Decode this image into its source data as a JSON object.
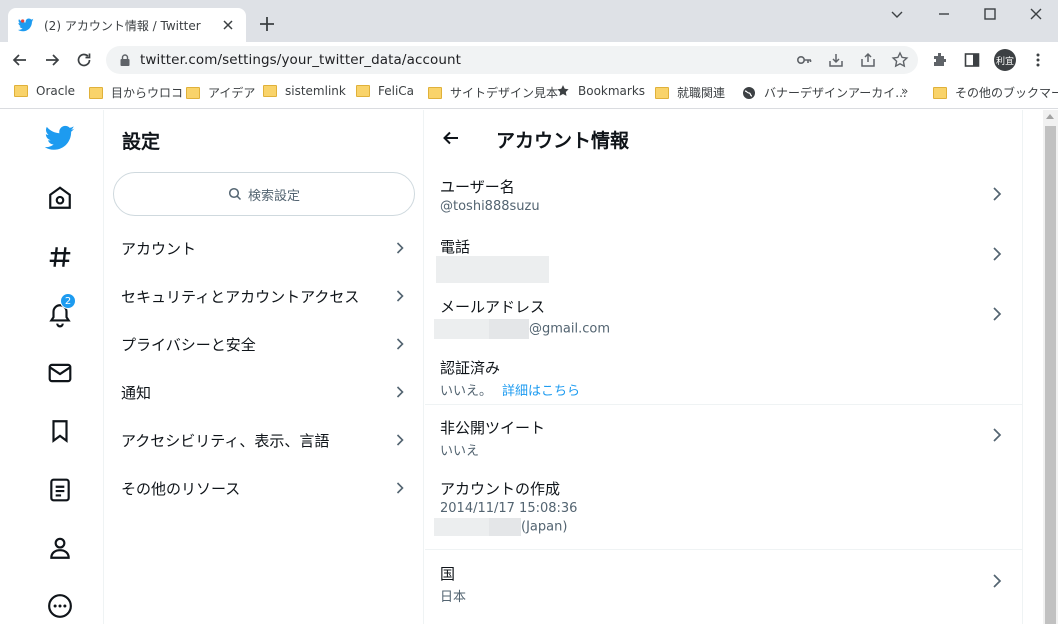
{
  "browser": {
    "tab_title": "(2) アカウント情報 / Twitter",
    "url": "twitter.com/settings/your_twitter_data/account",
    "profile_label": "利宜",
    "bookmarks": [
      {
        "label": "Oracle",
        "icon": "folder-icon"
      },
      {
        "label": "目からウロコ",
        "icon": "folder-icon"
      },
      {
        "label": "アイデア",
        "icon": "folder-icon"
      },
      {
        "label": "sistemlink",
        "icon": "folder-icon"
      },
      {
        "label": "FeliCa",
        "icon": "folder-icon"
      },
      {
        "label": "サイトデザイン見本",
        "icon": "folder-icon"
      },
      {
        "label": "Bookmarks",
        "icon": "star-icon"
      },
      {
        "label": "就職関連",
        "icon": "folder-icon"
      },
      {
        "label": "バナーデザインアーカイ...",
        "icon": "globe-icon"
      },
      {
        "label": "»",
        "icon": ""
      },
      {
        "label": "その他のブックマーク",
        "icon": "folder-icon"
      }
    ]
  },
  "nav": {
    "notification_count": "2",
    "brand_color": "#1d9bf0"
  },
  "settings": {
    "title": "設定",
    "search_placeholder": "検索設定",
    "items": [
      {
        "label": "アカウント"
      },
      {
        "label": "セキュリティとアカウントアクセス"
      },
      {
        "label": "プライバシーと安全"
      },
      {
        "label": "通知"
      },
      {
        "label": "アクセシビリティ、表示、言語"
      },
      {
        "label": "その他のリソース"
      }
    ]
  },
  "account": {
    "title": "アカウント情報",
    "username_label": "ユーザー名",
    "username_value": "@toshi888suzu",
    "phone_label": "電話",
    "email_label": "メールアドレス",
    "email_domain": "@gmail.com",
    "verified_label": "認証済み",
    "verified_value": "いいえ。",
    "verified_link": "詳細はこちら",
    "protected_label": "非公開ツイート",
    "protected_value": "いいえ",
    "created_label": "アカウントの作成",
    "created_value": "2014/11/17 15:08:36",
    "created_location_suffix": "(Japan)",
    "country_label": "国",
    "country_value": "日本"
  }
}
